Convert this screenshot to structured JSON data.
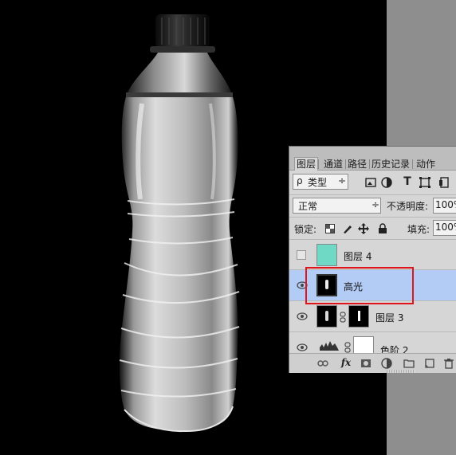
{
  "tabs": [
    {
      "label": "图层",
      "active": true
    },
    {
      "label": "通道",
      "active": false
    },
    {
      "label": "路径",
      "active": false
    },
    {
      "label": "历史记录",
      "active": false
    },
    {
      "label": "动作",
      "active": false
    }
  ],
  "filter": {
    "prefix": "ρ",
    "label": "类型",
    "arrows": "÷"
  },
  "blend": {
    "mode": "正常",
    "arrows": "÷",
    "opacity_label": "不透明度:",
    "opacity_value": "100%"
  },
  "lock": {
    "label": "锁定:",
    "fill_label": "填充:",
    "fill_value": "100%"
  },
  "layers": [
    {
      "name": "图层 4",
      "visible": false,
      "selected": false,
      "thumb_color": "#6fd9c6"
    },
    {
      "name": "高光",
      "visible": true,
      "selected": true
    },
    {
      "name": "图层 3",
      "visible": true,
      "selected": false
    },
    {
      "name": "色阶 2",
      "visible": true,
      "selected": false
    }
  ],
  "bottom_icons": [
    "link-icon",
    "fx-icon",
    "add-mask-icon",
    "adjustment-icon",
    "folder-icon",
    "new-layer-icon",
    "trash-icon"
  ],
  "fx_label": "fx",
  "colors": {
    "highlight": "#b3ccf5",
    "annotation": "#e0141b",
    "teal": "#6fd9c6"
  }
}
